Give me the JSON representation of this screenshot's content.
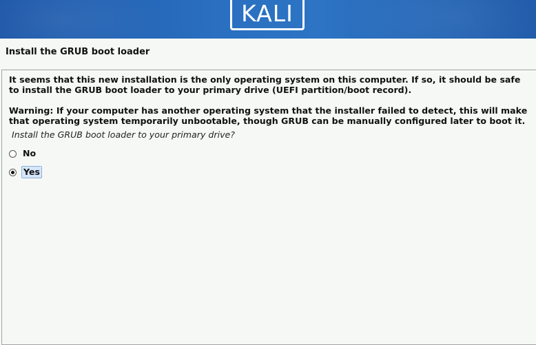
{
  "banner": {
    "logo_text": "KALI"
  },
  "page": {
    "title": "Install the GRUB boot loader"
  },
  "content": {
    "paragraph_1": "It seems that this new installation is the only operating system on this computer. If so, it should be safe to install the GRUB boot loader to your primary drive (UEFI partition/boot record).",
    "paragraph_2": "Warning: If your computer has another operating system that the installer failed to detect, this will make that operating system temporarily unbootable, though GRUB can be manually configured later to boot it.",
    "question": "Install the GRUB boot loader to your primary drive?",
    "options": [
      {
        "label": "No",
        "selected": false
      },
      {
        "label": "Yes",
        "selected": true
      }
    ]
  },
  "colors": {
    "banner_blue": "#2a6fc0",
    "background": "#f5f8f5",
    "focus_highlight": "#d6e6fb"
  }
}
